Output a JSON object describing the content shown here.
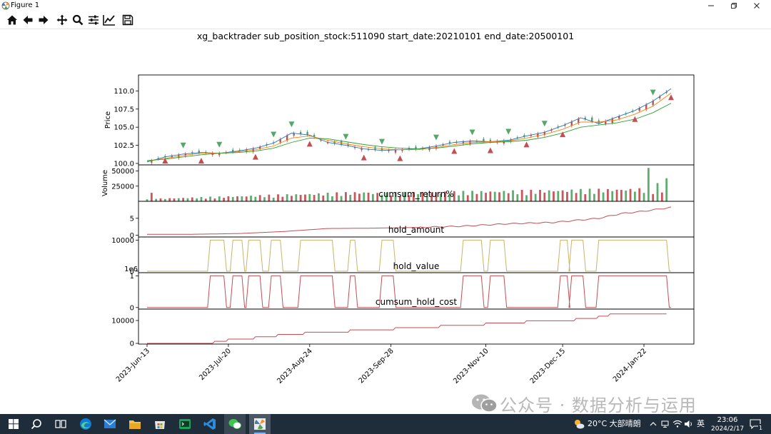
{
  "window": {
    "title": "Figure 1",
    "buttons": [
      "minimize",
      "restore",
      "close"
    ]
  },
  "toolbar": {
    "items": [
      {
        "name": "home-icon",
        "tooltip": "Home"
      },
      {
        "name": "back-arrow-icon",
        "tooltip": "Back"
      },
      {
        "name": "forward-arrow-icon",
        "tooltip": "Forward"
      },
      {
        "name": "pan-icon",
        "tooltip": "Pan"
      },
      {
        "name": "zoom-icon",
        "tooltip": "Zoom"
      },
      {
        "name": "configure-subplots-icon",
        "tooltip": "Subplots"
      },
      {
        "name": "edit-axis-icon",
        "tooltip": "Customize"
      },
      {
        "name": "save-icon",
        "tooltip": "Save"
      }
    ]
  },
  "figure": {
    "title": "xg_backtrader sub_position_stock:511090 start_date:20210101 end_date:20500101",
    "x_tick_labels": [
      "2023-Jun-13",
      "2023-Jul-20",
      "2023-Aug-24",
      "2023-Sep-28",
      "2023-Nov-10",
      "2023-Dec-15",
      "2024-Jan-22"
    ]
  },
  "chart_data": [
    {
      "type": "line",
      "panel": "price",
      "ylabel": "Price",
      "yticks": [
        "100.0",
        "102.5",
        "105.0",
        "107.5",
        "110.0"
      ],
      "ylim": [
        99.8,
        112.2
      ],
      "x": [
        0,
        8,
        16,
        24,
        32,
        40,
        48,
        56,
        64,
        72,
        80,
        88,
        96,
        104,
        112,
        120,
        128,
        136,
        144,
        152,
        160,
        168,
        176,
        184,
        192,
        200,
        208,
        216,
        224,
        232
      ],
      "series": [
        {
          "color": "#1f77b4",
          "values": [
            100.2,
            100.9,
            101.3,
            101.5,
            101.4,
            101.7,
            102.1,
            102.8,
            104.2,
            103.9,
            102.9,
            102.5,
            102.0,
            101.8,
            101.9,
            102.0,
            102.4,
            102.9,
            103.1,
            103.0,
            103.2,
            103.8,
            104.3,
            105.2,
            106.3,
            105.5,
            106.4,
            107.3,
            108.6,
            110.3
          ]
        },
        {
          "color": "#ff7f0e",
          "values": [
            100.3,
            100.7,
            101.1,
            101.4,
            101.4,
            101.6,
            101.9,
            102.4,
            103.5,
            103.8,
            103.2,
            102.7,
            102.3,
            102.0,
            101.9,
            101.9,
            102.2,
            102.6,
            102.9,
            103.0,
            103.1,
            103.5,
            104.0,
            104.7,
            105.7,
            105.7,
            106.0,
            106.8,
            107.9,
            109.7
          ]
        },
        {
          "color": "#2ca02c",
          "values": [
            100.4,
            100.6,
            100.9,
            101.2,
            101.4,
            101.5,
            101.7,
            102.1,
            102.9,
            103.5,
            103.4,
            103.0,
            102.6,
            102.3,
            102.1,
            102.0,
            102.1,
            102.4,
            102.7,
            102.9,
            103.0,
            103.2,
            103.6,
            104.2,
            105.0,
            105.3,
            105.6,
            106.1,
            107.0,
            108.3
          ]
        }
      ],
      "buy_markers_x": [
        16,
        32,
        56,
        64,
        88,
        104,
        128,
        144,
        160,
        176,
        224
      ],
      "sell_markers_x": [
        8,
        24,
        48,
        72,
        96,
        112,
        136,
        152,
        168,
        184,
        216,
        232
      ]
    },
    {
      "type": "bar",
      "panel": "volume",
      "ylabel": "Volume",
      "yticks": [
        "25000",
        "50000"
      ],
      "ylim": [
        0,
        60000
      ],
      "max_value": 55000
    },
    {
      "type": "line",
      "panel": "cumsum_return",
      "title": "cumsum_return%",
      "yticks": [
        "0",
        "5"
      ],
      "ylim": [
        -0.5,
        10
      ],
      "x": [
        0,
        20,
        40,
        60,
        80,
        100,
        120,
        140,
        160,
        180,
        200,
        210,
        220,
        232
      ],
      "values": [
        0.3,
        0.3,
        0.5,
        1.1,
        2.0,
        2.1,
        2.3,
        2.7,
        3.4,
        3.8,
        5.0,
        6.4,
        7.1,
        8.2
      ],
      "color": "#c44e52"
    },
    {
      "type": "line",
      "panel": "hold_amount",
      "title": "hold_amount",
      "yticks": [
        "0",
        "10000"
      ],
      "ylim": [
        -500,
        11000
      ],
      "color": "#c9b36b",
      "hold_intervals": [
        [
          28,
          34
        ],
        [
          38,
          42
        ],
        [
          45,
          50
        ],
        [
          55,
          59
        ],
        [
          68,
          82
        ],
        [
          90,
          92
        ],
        [
          104,
          109
        ],
        [
          140,
          148
        ],
        [
          152,
          158
        ],
        [
          183,
          186
        ],
        [
          188,
          193
        ],
        [
          200,
          230
        ]
      ]
    },
    {
      "type": "line",
      "panel": "hold_value",
      "title": "hold_value",
      "offset_label": "1e6",
      "yticks": [
        "0",
        "1"
      ],
      "ylim": [
        -0.05,
        1.1
      ],
      "color": "#c44e52",
      "hold_intervals": [
        [
          28,
          34
        ],
        [
          38,
          42
        ],
        [
          45,
          50
        ],
        [
          55,
          59
        ],
        [
          68,
          82
        ],
        [
          90,
          92
        ],
        [
          104,
          109
        ],
        [
          140,
          148
        ],
        [
          152,
          158
        ],
        [
          183,
          186
        ],
        [
          188,
          193
        ],
        [
          200,
          230
        ]
      ]
    },
    {
      "type": "line",
      "panel": "cumsum_hold_cost",
      "title": "cumsum_hold_cost",
      "yticks": [
        "0",
        "10000"
      ],
      "ylim": [
        -300,
        15000
      ],
      "color": "#c44e52",
      "steps": [
        [
          0,
          0
        ],
        [
          30,
          900
        ],
        [
          36,
          1900
        ],
        [
          48,
          2900
        ],
        [
          58,
          3900
        ],
        [
          70,
          4900
        ],
        [
          90,
          5900
        ],
        [
          110,
          6900
        ],
        [
          130,
          7900
        ],
        [
          150,
          8900
        ],
        [
          168,
          9900
        ],
        [
          190,
          10900
        ],
        [
          200,
          11900
        ],
        [
          205,
          12900
        ],
        [
          230,
          12900
        ]
      ]
    }
  ],
  "taskbar": {
    "weather": "20°C 大部晴朗",
    "ime": "英",
    "time": "23:06",
    "date": "2024/2/17",
    "notification_count": "1"
  },
  "watermark": {
    "text": "公众号 · 数据分析与运用"
  }
}
